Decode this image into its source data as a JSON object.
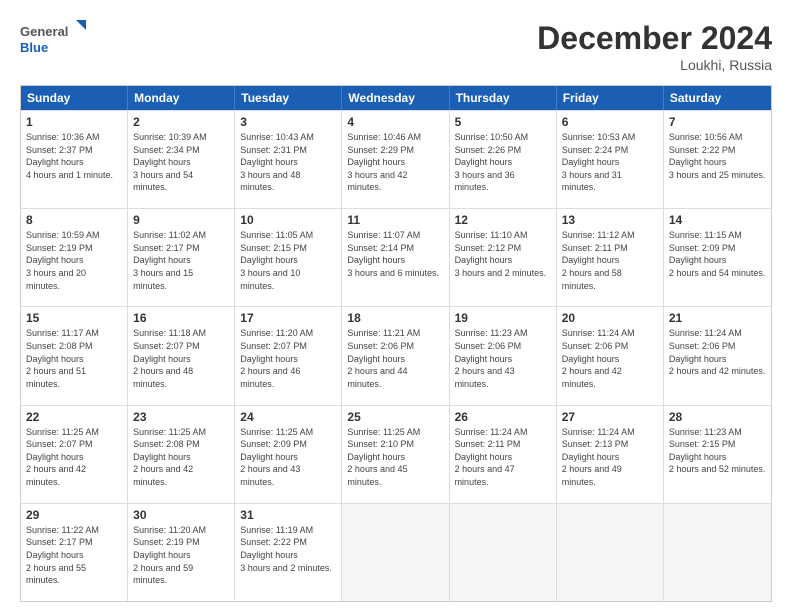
{
  "header": {
    "logo_line1": "General",
    "logo_line2": "Blue",
    "month": "December 2024",
    "location": "Loukhi, Russia"
  },
  "days_of_week": [
    "Sunday",
    "Monday",
    "Tuesday",
    "Wednesday",
    "Thursday",
    "Friday",
    "Saturday"
  ],
  "rows": [
    [
      {
        "day": "1",
        "sunrise": "10:36 AM",
        "sunset": "2:37 PM",
        "daylight": "4 hours and 1 minute."
      },
      {
        "day": "2",
        "sunrise": "10:39 AM",
        "sunset": "2:34 PM",
        "daylight": "3 hours and 54 minutes."
      },
      {
        "day": "3",
        "sunrise": "10:43 AM",
        "sunset": "2:31 PM",
        "daylight": "3 hours and 48 minutes."
      },
      {
        "day": "4",
        "sunrise": "10:46 AM",
        "sunset": "2:29 PM",
        "daylight": "3 hours and 42 minutes."
      },
      {
        "day": "5",
        "sunrise": "10:50 AM",
        "sunset": "2:26 PM",
        "daylight": "3 hours and 36 minutes."
      },
      {
        "day": "6",
        "sunrise": "10:53 AM",
        "sunset": "2:24 PM",
        "daylight": "3 hours and 31 minutes."
      },
      {
        "day": "7",
        "sunrise": "10:56 AM",
        "sunset": "2:22 PM",
        "daylight": "3 hours and 25 minutes."
      }
    ],
    [
      {
        "day": "8",
        "sunrise": "10:59 AM",
        "sunset": "2:19 PM",
        "daylight": "3 hours and 20 minutes."
      },
      {
        "day": "9",
        "sunrise": "11:02 AM",
        "sunset": "2:17 PM",
        "daylight": "3 hours and 15 minutes."
      },
      {
        "day": "10",
        "sunrise": "11:05 AM",
        "sunset": "2:15 PM",
        "daylight": "3 hours and 10 minutes."
      },
      {
        "day": "11",
        "sunrise": "11:07 AM",
        "sunset": "2:14 PM",
        "daylight": "3 hours and 6 minutes."
      },
      {
        "day": "12",
        "sunrise": "11:10 AM",
        "sunset": "2:12 PM",
        "daylight": "3 hours and 2 minutes."
      },
      {
        "day": "13",
        "sunrise": "11:12 AM",
        "sunset": "2:11 PM",
        "daylight": "2 hours and 58 minutes."
      },
      {
        "day": "14",
        "sunrise": "11:15 AM",
        "sunset": "2:09 PM",
        "daylight": "2 hours and 54 minutes."
      }
    ],
    [
      {
        "day": "15",
        "sunrise": "11:17 AM",
        "sunset": "2:08 PM",
        "daylight": "2 hours and 51 minutes."
      },
      {
        "day": "16",
        "sunrise": "11:18 AM",
        "sunset": "2:07 PM",
        "daylight": "2 hours and 48 minutes."
      },
      {
        "day": "17",
        "sunrise": "11:20 AM",
        "sunset": "2:07 PM",
        "daylight": "2 hours and 46 minutes."
      },
      {
        "day": "18",
        "sunrise": "11:21 AM",
        "sunset": "2:06 PM",
        "daylight": "2 hours and 44 minutes."
      },
      {
        "day": "19",
        "sunrise": "11:23 AM",
        "sunset": "2:06 PM",
        "daylight": "2 hours and 43 minutes."
      },
      {
        "day": "20",
        "sunrise": "11:24 AM",
        "sunset": "2:06 PM",
        "daylight": "2 hours and 42 minutes."
      },
      {
        "day": "21",
        "sunrise": "11:24 AM",
        "sunset": "2:06 PM",
        "daylight": "2 hours and 42 minutes."
      }
    ],
    [
      {
        "day": "22",
        "sunrise": "11:25 AM",
        "sunset": "2:07 PM",
        "daylight": "2 hours and 42 minutes."
      },
      {
        "day": "23",
        "sunrise": "11:25 AM",
        "sunset": "2:08 PM",
        "daylight": "2 hours and 42 minutes."
      },
      {
        "day": "24",
        "sunrise": "11:25 AM",
        "sunset": "2:09 PM",
        "daylight": "2 hours and 43 minutes."
      },
      {
        "day": "25",
        "sunrise": "11:25 AM",
        "sunset": "2:10 PM",
        "daylight": "2 hours and 45 minutes."
      },
      {
        "day": "26",
        "sunrise": "11:24 AM",
        "sunset": "2:11 PM",
        "daylight": "2 hours and 47 minutes."
      },
      {
        "day": "27",
        "sunrise": "11:24 AM",
        "sunset": "2:13 PM",
        "daylight": "2 hours and 49 minutes."
      },
      {
        "day": "28",
        "sunrise": "11:23 AM",
        "sunset": "2:15 PM",
        "daylight": "2 hours and 52 minutes."
      }
    ],
    [
      {
        "day": "29",
        "sunrise": "11:22 AM",
        "sunset": "2:17 PM",
        "daylight": "2 hours and 55 minutes."
      },
      {
        "day": "30",
        "sunrise": "11:20 AM",
        "sunset": "2:19 PM",
        "daylight": "2 hours and 59 minutes."
      },
      {
        "day": "31",
        "sunrise": "11:19 AM",
        "sunset": "2:22 PM",
        "daylight": "3 hours and 2 minutes."
      },
      null,
      null,
      null,
      null
    ]
  ]
}
